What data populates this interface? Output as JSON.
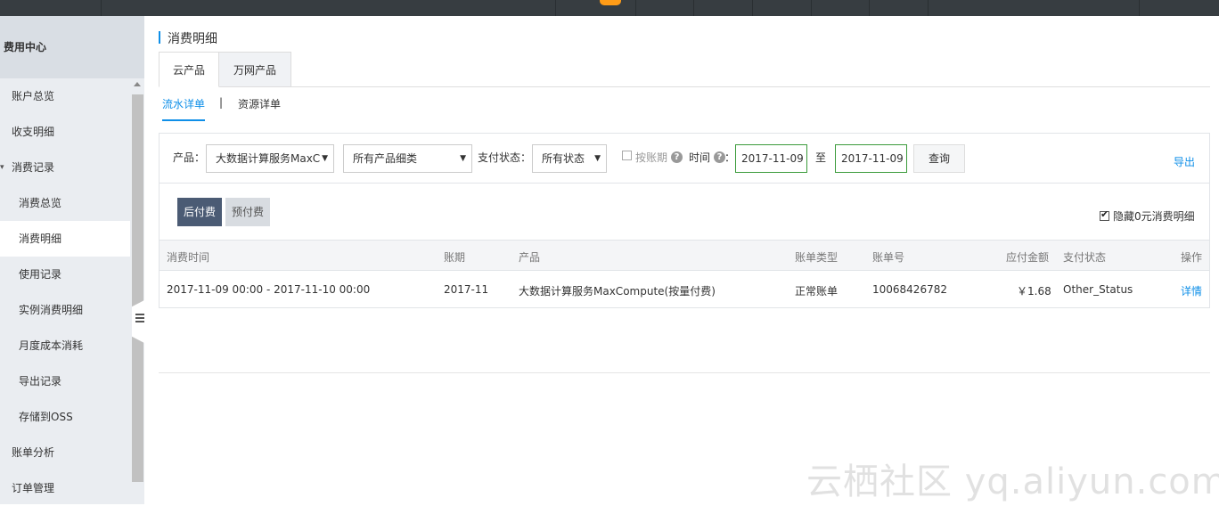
{
  "sidebar": {
    "title": "费用中心",
    "items": [
      {
        "label": "账户总览"
      },
      {
        "label": "收支明细"
      },
      {
        "label": "消费记录"
      },
      {
        "label": "消费总览"
      },
      {
        "label": "消费明细"
      },
      {
        "label": "使用记录"
      },
      {
        "label": "实例消费明细"
      },
      {
        "label": "月度成本消耗"
      },
      {
        "label": "导出记录"
      },
      {
        "label": "存储到OSS"
      },
      {
        "label": "账单分析"
      },
      {
        "label": "订单管理"
      }
    ]
  },
  "page": {
    "title": "消费明细"
  },
  "tabs": [
    {
      "label": "云产品"
    },
    {
      "label": "万网产品"
    }
  ],
  "subtabs": {
    "active": "流水详单",
    "divider": "|",
    "other": "资源详单"
  },
  "filter": {
    "product_label": "产品：",
    "product_value": "大数据计算服务MaxC",
    "detail_value": "所有产品细类",
    "status_label": "支付状态：",
    "status_value": "所有状态",
    "by_period_label": "按账期",
    "time_label": "时间",
    "colon": "：",
    "help": "?",
    "date_from": "2017-11-09",
    "to_label": "至",
    "date_to": "2017-11-09",
    "query_button": "查询",
    "export": "导出"
  },
  "billing": {
    "postpaid": "后付费",
    "prepaid": "预付费",
    "hide_zero": "隐藏0元消费明细"
  },
  "table": {
    "headers": [
      "消费时间",
      "账期",
      "产品",
      "账单类型",
      "账单号",
      "应付金额",
      "支付状态",
      "操作"
    ],
    "rows": [
      [
        "2017-11-09 00:00 - 2017-11-10 00:00",
        "2017-11",
        "大数据计算服务MaxCompute(按量付费)",
        "正常账单",
        "10068426782",
        "￥1.68",
        "Other_Status",
        "详情"
      ]
    ]
  },
  "watermark": "云栖社区 yq.aliyun.com"
}
